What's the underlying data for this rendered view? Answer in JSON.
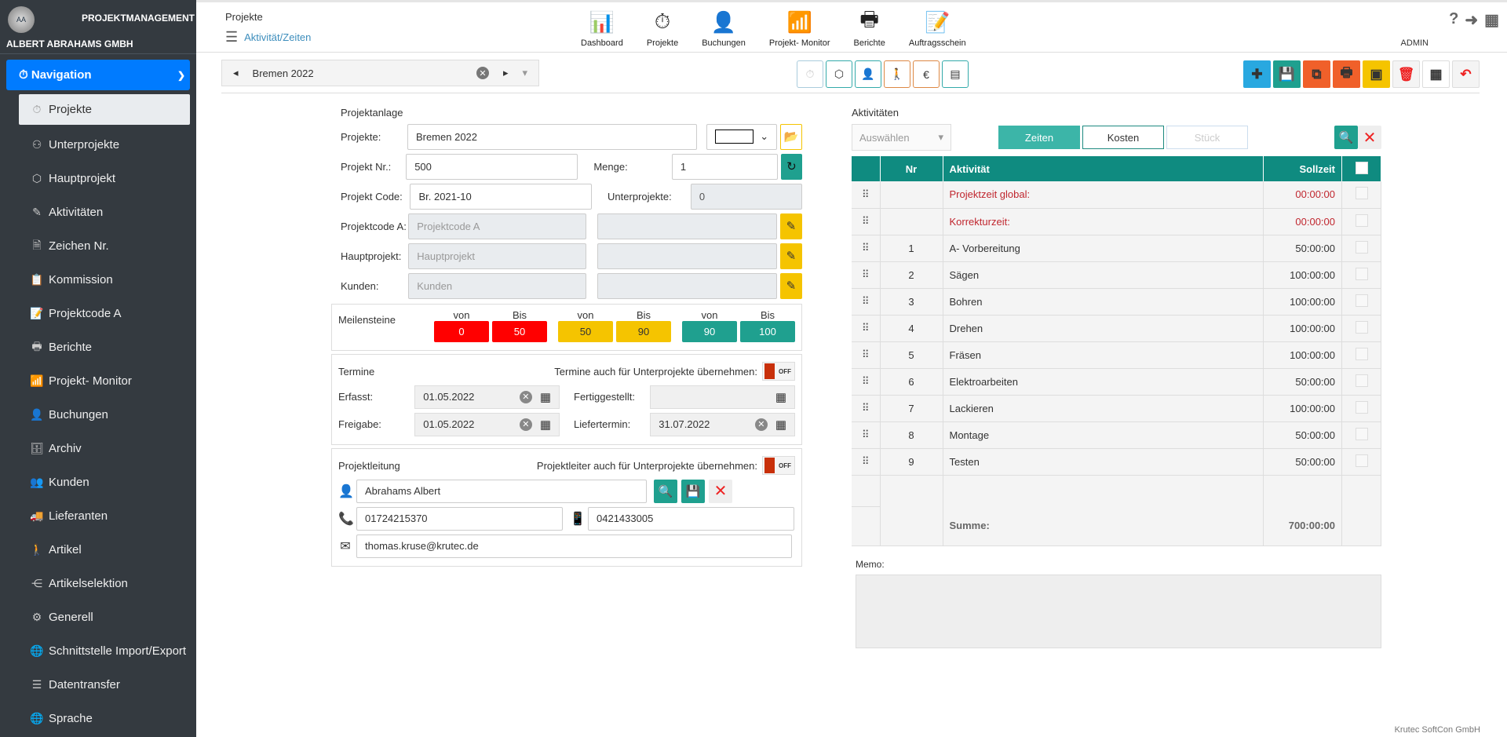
{
  "sidebar": {
    "logo_text": "AA",
    "brand": "PROJEKTMANAGEMENT",
    "company": "ALBERT ABRAHAMS GMBH",
    "nav_label": "Navigation",
    "items": [
      {
        "label": "Projekte",
        "icon": "stopwatch-icon"
      },
      {
        "label": "Unterprojekte",
        "icon": "hierarchy-icon"
      },
      {
        "label": "Hauptprojekt",
        "icon": "cube-icon"
      },
      {
        "label": "Aktivitäten",
        "icon": "edit-list-icon"
      },
      {
        "label": "Zeichen Nr.",
        "icon": "document-icon"
      },
      {
        "label": "Kommission",
        "icon": "clipboard-icon"
      },
      {
        "label": "Projektcode A",
        "icon": "clipboard-edit-icon"
      },
      {
        "label": "Berichte",
        "icon": "printer-icon"
      },
      {
        "label": "Projekt- Monitor",
        "icon": "bar-chart-icon"
      },
      {
        "label": "Buchungen",
        "icon": "booking-icon"
      },
      {
        "label": "Archiv",
        "icon": "archive-icon"
      },
      {
        "label": "Kunden",
        "icon": "customer-icon"
      },
      {
        "label": "Lieferanten",
        "icon": "truck-icon"
      },
      {
        "label": "Artikel",
        "icon": "article-icon"
      },
      {
        "label": "Artikelselektion",
        "icon": "share-icon"
      },
      {
        "label": "Generell",
        "icon": "settings-icon"
      },
      {
        "label": "Schnittstelle Import/Export",
        "icon": "globe-exchange-icon"
      },
      {
        "label": "Datentransfer",
        "icon": "server-icon"
      },
      {
        "label": "Sprache",
        "icon": "globe-icon"
      }
    ]
  },
  "header": {
    "title": "Projekte",
    "subtitle": "Aktivität/Zeiten",
    "user": "ADMIN",
    "nav": [
      {
        "label": "Dashboard",
        "icon": "📊"
      },
      {
        "label": "Projekte",
        "icon": "⏱"
      },
      {
        "label": "Buchungen",
        "icon": "👤"
      },
      {
        "label": "Projekt- Monitor",
        "icon": "📶"
      },
      {
        "label": "Berichte",
        "icon": "🖶"
      },
      {
        "label": "Auftragsschein",
        "icon": "📝"
      }
    ]
  },
  "project_selector": {
    "value": "Bremen 2022"
  },
  "colors": {
    "accent": "#0f8b80",
    "blue": "#007bff",
    "yellow": "#f5c400",
    "red": "#ff0000"
  },
  "form": {
    "section": "Projektanlage",
    "projekte_label": "Projekte:",
    "projekte_value": "Bremen 2022",
    "nr_label": "Projekt Nr.:",
    "nr_value": "500",
    "menge_label": "Menge:",
    "menge_value": "1",
    "code_label": "Projekt Code:",
    "code_value": "Br. 2021-10",
    "unter_label": "Unterprojekte:",
    "unter_value": "0",
    "codea_label": "Projektcode A:",
    "codea_placeholder": "Projektcode A",
    "haupt_label": "Hauptprojekt:",
    "haupt_placeholder": "Hauptprojekt",
    "kunden_label": "Kunden:",
    "kunden_placeholder": "Kunden"
  },
  "milestones": {
    "label": "Meilensteine",
    "von": "von",
    "bis": "Bis",
    "groups": [
      {
        "von": "0",
        "bis": "50",
        "color": "#ff0000",
        "text": "#fff"
      },
      {
        "von": "50",
        "bis": "90",
        "color": "#f5c400",
        "text": "#333"
      },
      {
        "von": "90",
        "bis": "100",
        "color": "#1fa08f",
        "text": "#fff"
      }
    ]
  },
  "termine": {
    "title": "Termine",
    "toggle_label": "Termine auch für Unterprojekte übernehmen:",
    "toggle": "OFF",
    "erfasst_label": "Erfasst:",
    "erfasst": "01.05.2022",
    "fertig_label": "Fertiggestellt:",
    "fertig": "",
    "freigabe_label": "Freigabe:",
    "freigabe": "01.05.2022",
    "liefer_label": "Liefertermin:",
    "liefer": "31.07.2022"
  },
  "leitung": {
    "title": "Projektleitung",
    "toggle_label": "Projektleiter auch für Unterprojekte übernehmen:",
    "toggle": "OFF",
    "name": "Abrahams  Albert",
    "phone": "01724215370",
    "mobile": "0421433005",
    "email": "thomas.kruse@krutec.de"
  },
  "activities": {
    "title": "Aktivitäten",
    "select_placeholder": "Auswählen",
    "tabs": [
      "Zeiten",
      "Kosten",
      "Stück"
    ],
    "columns": [
      "Nr",
      "Aktivität",
      "Sollzeit"
    ],
    "rows": [
      {
        "nr": "",
        "name": "Projektzeit global:",
        "time": "00:00:00",
        "red": true
      },
      {
        "nr": "",
        "name": "Korrekturzeit:",
        "time": "00:00:00",
        "red": true
      },
      {
        "nr": "1",
        "name": "A- Vorbereitung",
        "time": "50:00:00"
      },
      {
        "nr": "2",
        "name": "Sägen",
        "time": "100:00:00"
      },
      {
        "nr": "3",
        "name": "Bohren",
        "time": "100:00:00"
      },
      {
        "nr": "4",
        "name": "Drehen",
        "time": "100:00:00"
      },
      {
        "nr": "5",
        "name": "Fräsen",
        "time": "100:00:00"
      },
      {
        "nr": "6",
        "name": "Elektroarbeiten",
        "time": "50:00:00"
      },
      {
        "nr": "7",
        "name": "Lackieren",
        "time": "100:00:00"
      },
      {
        "nr": "8",
        "name": "Montage",
        "time": "50:00:00"
      },
      {
        "nr": "9",
        "name": "Testen",
        "time": "50:00:00"
      }
    ],
    "sum_label": "Summe:",
    "sum_value": "700:00:00"
  },
  "memo_label": "Memo:",
  "footer": "Krutec SoftCon GmbH"
}
